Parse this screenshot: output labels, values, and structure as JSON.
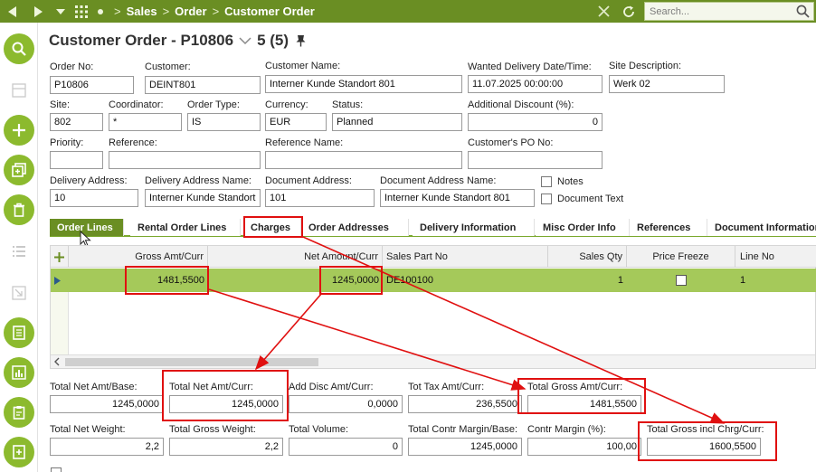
{
  "nav": {
    "breadcrumb": [
      "Sales",
      "Order",
      "Customer Order"
    ],
    "search_placeholder": "Search..."
  },
  "header": {
    "title": "Customer Order - P10806",
    "record_position": "5 (5)"
  },
  "fields": {
    "order_no": {
      "label": "Order No:",
      "value": "P10806"
    },
    "customer": {
      "label": "Customer:",
      "value": "DEINT801"
    },
    "customer_name": {
      "label": "Customer Name:",
      "value": "Interner Kunde Standort 801"
    },
    "wanted_delivery": {
      "label": "Wanted Delivery Date/Time:",
      "value": "11.07.2025 00:00:00"
    },
    "site_description": {
      "label": "Site Description:",
      "value": "Werk 02"
    },
    "site": {
      "label": "Site:",
      "value": "802"
    },
    "coordinator": {
      "label": "Coordinator:",
      "value": "*"
    },
    "order_type": {
      "label": "Order Type:",
      "value": "IS"
    },
    "currency": {
      "label": "Currency:",
      "value": "EUR"
    },
    "status": {
      "label": "Status:",
      "value": "Planned"
    },
    "additional_discount": {
      "label": "Additional Discount (%):",
      "value": "0"
    },
    "priority": {
      "label": "Priority:",
      "value": ""
    },
    "reference": {
      "label": "Reference:",
      "value": ""
    },
    "reference_name": {
      "label": "Reference Name:",
      "value": ""
    },
    "customer_po": {
      "label": "Customer's PO No:",
      "value": ""
    },
    "delivery_address": {
      "label": "Delivery Address:",
      "value": "10"
    },
    "delivery_address_name": {
      "label": "Delivery Address Name:",
      "value": "Interner Kunde Standort 801"
    },
    "document_address": {
      "label": "Document Address:",
      "value": "101"
    },
    "document_address_name": {
      "label": "Document Address Name:",
      "value": "Interner Kunde Standort 801"
    },
    "notes": {
      "label": "Notes"
    },
    "document_text": {
      "label": "Document Text"
    }
  },
  "tabs": [
    "Order Lines",
    "Rental Order Lines",
    "Charges",
    "Order Addresses",
    "Delivery Information",
    "Misc Order Info",
    "References",
    "Document Information"
  ],
  "grid": {
    "columns": [
      "Gross Amt/Curr",
      "Net Amount/Curr",
      "Sales Part No",
      "Sales Qty",
      "Price Freeze",
      "Line No"
    ],
    "rows": [
      {
        "gross_amt": "1481,5500",
        "net_amount": "1245,0000",
        "sales_part_no": "DE100100",
        "sales_qty": "1",
        "line_no": "1"
      }
    ]
  },
  "totals": {
    "total_net_amt_base": {
      "label": "Total Net Amt/Base:",
      "value": "1245,0000"
    },
    "total_net_amt_curr": {
      "label": "Total Net Amt/Curr:",
      "value": "1245,0000"
    },
    "add_disc_amt_curr": {
      "label": "Add Disc Amt/Curr:",
      "value": "0,0000"
    },
    "tot_tax_amt_curr": {
      "label": "Tot Tax Amt/Curr:",
      "value": "236,5500"
    },
    "total_gross_amt_curr": {
      "label": "Total Gross Amt/Curr:",
      "value": "1481,5500"
    },
    "total_net_weight": {
      "label": "Total Net Weight:",
      "value": "2,2"
    },
    "total_gross_weight": {
      "label": "Total Gross Weight:",
      "value": "2,2"
    },
    "total_volume": {
      "label": "Total Volume:",
      "value": "0"
    },
    "total_contr_margin_base": {
      "label": "Total Contr Margin/Base:",
      "value": "1245,0000"
    },
    "contr_margin_pct": {
      "label": "Contr Margin (%):",
      "value": "100,00"
    },
    "total_gross_incl_chrg": {
      "label": "Total Gross incl Chrg/Curr:",
      "value": "1600,5500"
    }
  },
  "colors": {
    "topbar": "#6a8e23",
    "rail_button": "#8cba2e",
    "selected_row": "#a5c95a",
    "annotation": "#e01010"
  }
}
